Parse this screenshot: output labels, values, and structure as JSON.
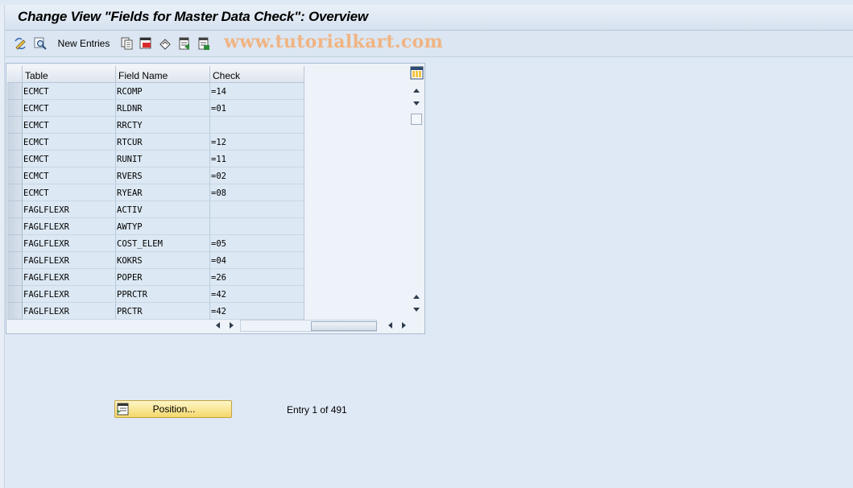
{
  "window": {
    "title": "Change View \"Fields for Master Data Check\": Overview"
  },
  "toolbar": {
    "items": [
      {
        "icon": "display-change-icon"
      },
      {
        "icon": "find-icon"
      },
      {
        "label": "New Entries"
      },
      {
        "icon": "copy-icon"
      },
      {
        "icon": "delete-icon"
      },
      {
        "icon": "undo-icon"
      },
      {
        "icon": "select-all-icon"
      },
      {
        "icon": "deselect-all-icon"
      }
    ],
    "watermark": "www.tutorialkart.com"
  },
  "table": {
    "columns": [
      "Table",
      "Field Name",
      "Check"
    ],
    "rows": [
      [
        "ECMCT",
        "RCOMP",
        "=14"
      ],
      [
        "ECMCT",
        "RLDNR",
        "=01"
      ],
      [
        "ECMCT",
        "RRCTY",
        ""
      ],
      [
        "ECMCT",
        "RTCUR",
        "=12"
      ],
      [
        "ECMCT",
        "RUNIT",
        "=11"
      ],
      [
        "ECMCT",
        "RVERS",
        "=02"
      ],
      [
        "ECMCT",
        "RYEAR",
        "=08"
      ],
      [
        "FAGLFLEXR",
        "ACTIV",
        ""
      ],
      [
        "FAGLFLEXR",
        "AWTYP",
        ""
      ],
      [
        "FAGLFLEXR",
        "COST_ELEM",
        "=05"
      ],
      [
        "FAGLFLEXR",
        "KOKRS",
        "=04"
      ],
      [
        "FAGLFLEXR",
        "POPER",
        "=26"
      ],
      [
        "FAGLFLEXR",
        "PPRCTR",
        "=42"
      ],
      [
        "FAGLFLEXR",
        "PRCTR",
        "=42"
      ]
    ]
  },
  "footer": {
    "position_button": "Position...",
    "entry_info": "Entry 1 of 491"
  }
}
